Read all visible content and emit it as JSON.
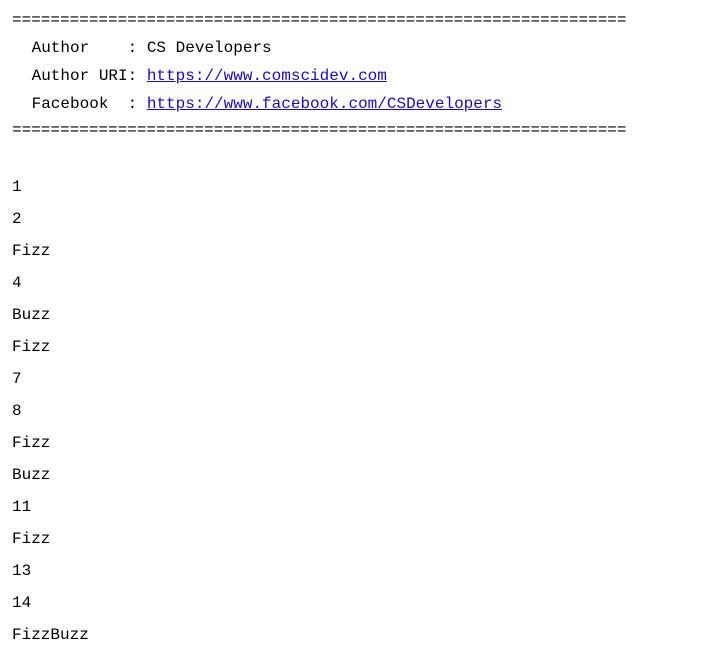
{
  "divider": "================================================================",
  "header": {
    "author_label": " Author    : ",
    "author_value": "CS Developers",
    "author_uri_label": " Author URI: ",
    "author_uri_value": "https://www.comscidev.com",
    "facebook_label": " Facebook  : ",
    "facebook_value": "https://www.facebook.com/CSDevelopers"
  },
  "output": {
    "lines": [
      "1",
      "2",
      "Fizz",
      "4",
      "Buzz",
      "Fizz",
      "7",
      "8",
      "Fizz",
      "Buzz",
      "11",
      "Fizz",
      "13",
      "14",
      "FizzBuzz"
    ]
  }
}
